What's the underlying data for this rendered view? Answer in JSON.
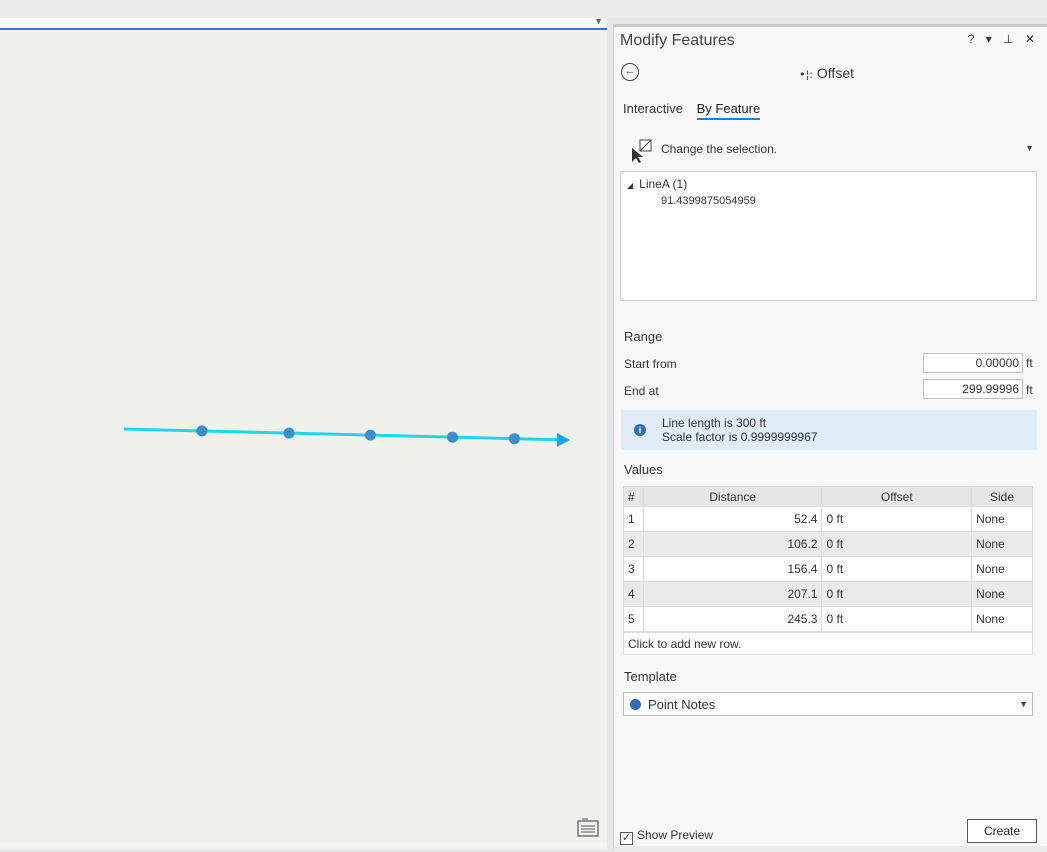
{
  "pane": {
    "title": "Modify Features",
    "controls": "? ▾ ⊥ ✕",
    "tool": "Offset",
    "tabs": [
      "Interactive",
      "By Feature"
    ],
    "selection_hint": "Change the selection.",
    "tree": {
      "layer": "LineA (1)",
      "feature": "91.4399875054959"
    },
    "range": {
      "heading": "Range",
      "start_label": "Start from",
      "start_value": "0.00000",
      "end_label": "End at",
      "end_value": "299.99996",
      "unit": "ft"
    },
    "info": {
      "line1": "Line length is 300 ft",
      "line2": "Scale factor is 0.9999999967"
    },
    "values": {
      "heading": "Values",
      "columns": [
        "#",
        "Distance",
        "Offset",
        "Side"
      ],
      "rows": [
        [
          "1",
          "52.4",
          "0 ft",
          "None"
        ],
        [
          "2",
          "106.2",
          "0 ft",
          "None"
        ],
        [
          "3",
          "156.4",
          "0 ft",
          "None"
        ],
        [
          "4",
          "207.1",
          "0 ft",
          "None"
        ],
        [
          "5",
          "245.3",
          "0 ft",
          "None"
        ]
      ],
      "add_row": "Click to add new row."
    },
    "template": {
      "heading": "Template",
      "selected": "Point Notes"
    },
    "preview_label": "Show Preview",
    "create_label": "Create"
  },
  "map": {
    "line_color": "#1ed6f0",
    "point_color": "#3d8ec9",
    "arrow_color": "#1aa3f5",
    "point_distances": [
      52.4,
      106.2,
      156.4,
      207.1,
      245.3
    ],
    "line_length": 300
  },
  "icons": [
    "back-arrow-icon",
    "offset-icon",
    "selection-cursor-icon",
    "info-icon",
    "map-legend-icon"
  ]
}
